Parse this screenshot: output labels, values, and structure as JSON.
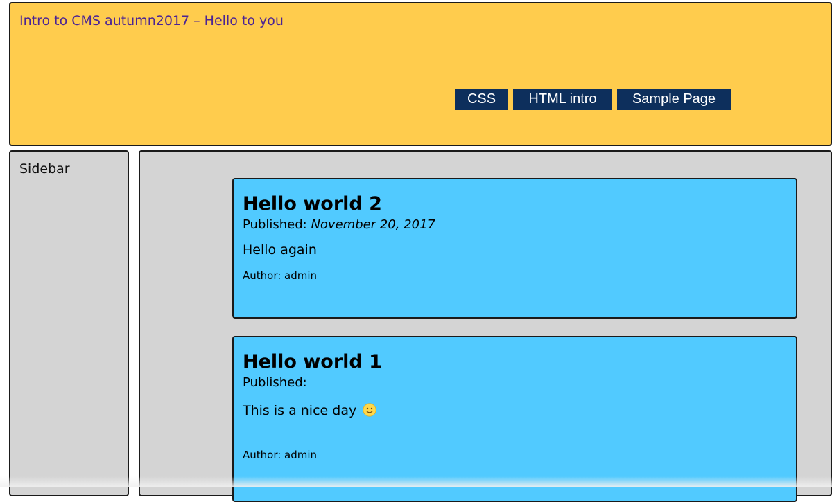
{
  "header": {
    "site_title": "Intro to CMS autumn2017 – Hello to you",
    "nav": [
      "CSS",
      "HTML intro",
      "Sample Page"
    ]
  },
  "sidebar": {
    "title": "Sidebar"
  },
  "posts": [
    {
      "title": "Hello world 2",
      "published_label": "Published: ",
      "published_date": "November 20, 2017",
      "body": "Hello again",
      "author": "Author: admin"
    },
    {
      "title": "Hello world 1",
      "published_label": "Published: ",
      "published_date": "",
      "body": "This is a nice day",
      "body_icon": "slightly-smiling-face-icon",
      "author": "Author: admin"
    }
  ],
  "colors": {
    "header_bg": "#ffcc4d",
    "nav_bg": "#0d2f5c",
    "panel_bg": "#d4d4d4",
    "post_bg": "#51caff",
    "link": "#4b2494"
  }
}
